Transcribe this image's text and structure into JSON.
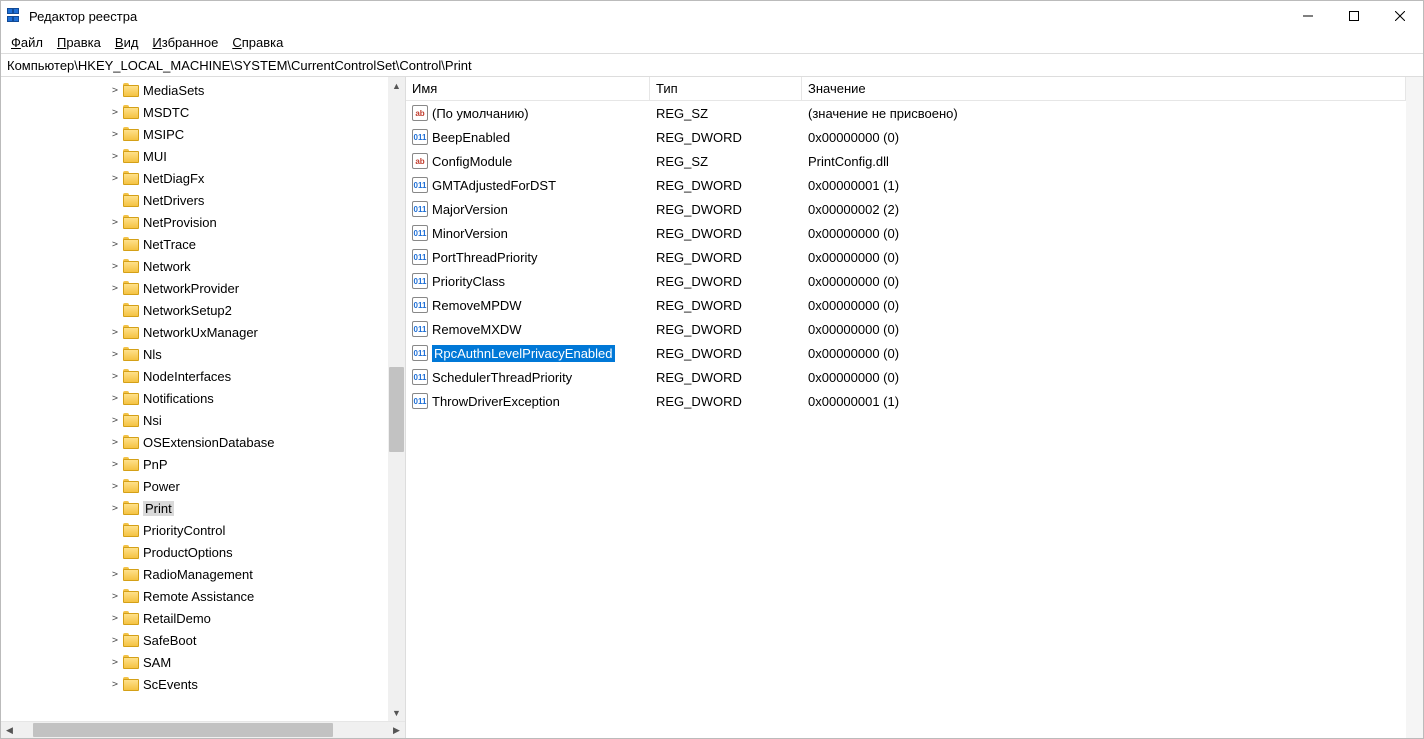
{
  "window": {
    "title": "Редактор реестра"
  },
  "menu": {
    "file": {
      "text": "Файл",
      "ul": "Ф",
      "rest": "айл"
    },
    "edit": {
      "text": "Правка",
      "ul": "П",
      "rest": "равка"
    },
    "view": {
      "text": "Вид",
      "ul": "В",
      "rest": "ид"
    },
    "fav": {
      "text": "Избранное",
      "ul": "И",
      "rest": "збранное"
    },
    "help": {
      "text": "Справка",
      "ul": "С",
      "rest": "правка"
    }
  },
  "address": "Компьютер\\HKEY_LOCAL_MACHINE\\SYSTEM\\CurrentControlSet\\Control\\Print",
  "tree": [
    {
      "indent": 128,
      "expand": ">",
      "label": "MediaSets"
    },
    {
      "indent": 128,
      "expand": ">",
      "label": "MSDTC"
    },
    {
      "indent": 128,
      "expand": ">",
      "label": "MSIPC"
    },
    {
      "indent": 128,
      "expand": ">",
      "label": "MUI"
    },
    {
      "indent": 128,
      "expand": ">",
      "label": "NetDiagFx"
    },
    {
      "indent": 128,
      "expand": "",
      "label": "NetDrivers"
    },
    {
      "indent": 128,
      "expand": ">",
      "label": "NetProvision"
    },
    {
      "indent": 128,
      "expand": ">",
      "label": "NetTrace"
    },
    {
      "indent": 128,
      "expand": ">",
      "label": "Network"
    },
    {
      "indent": 128,
      "expand": ">",
      "label": "NetworkProvider"
    },
    {
      "indent": 128,
      "expand": "",
      "label": "NetworkSetup2"
    },
    {
      "indent": 128,
      "expand": ">",
      "label": "NetworkUxManager"
    },
    {
      "indent": 128,
      "expand": ">",
      "label": "Nls"
    },
    {
      "indent": 128,
      "expand": ">",
      "label": "NodeInterfaces"
    },
    {
      "indent": 128,
      "expand": ">",
      "label": "Notifications"
    },
    {
      "indent": 128,
      "expand": ">",
      "label": "Nsi"
    },
    {
      "indent": 128,
      "expand": ">",
      "label": "OSExtensionDatabase"
    },
    {
      "indent": 128,
      "expand": ">",
      "label": "PnP"
    },
    {
      "indent": 128,
      "expand": ">",
      "label": "Power"
    },
    {
      "indent": 128,
      "expand": ">",
      "label": "Print",
      "selected": true
    },
    {
      "indent": 128,
      "expand": "",
      "label": "PriorityControl"
    },
    {
      "indent": 128,
      "expand": "",
      "label": "ProductOptions"
    },
    {
      "indent": 128,
      "expand": ">",
      "label": "RadioManagement"
    },
    {
      "indent": 128,
      "expand": ">",
      "label": "Remote Assistance"
    },
    {
      "indent": 128,
      "expand": ">",
      "label": "RetailDemo"
    },
    {
      "indent": 128,
      "expand": ">",
      "label": "SafeBoot"
    },
    {
      "indent": 128,
      "expand": ">",
      "label": "SAM"
    },
    {
      "indent": 128,
      "expand": ">",
      "label": "ScEvents"
    }
  ],
  "list": {
    "headers": {
      "name": "Имя",
      "type": "Тип",
      "value": "Значение"
    },
    "rows": [
      {
        "icon": "sz",
        "name": "(По умолчанию)",
        "type": "REG_SZ",
        "value": "(значение не присвоено)"
      },
      {
        "icon": "dw",
        "name": "BeepEnabled",
        "type": "REG_DWORD",
        "value": "0x00000000 (0)"
      },
      {
        "icon": "sz",
        "name": "ConfigModule",
        "type": "REG_SZ",
        "value": "PrintConfig.dll"
      },
      {
        "icon": "dw",
        "name": "GMTAdjustedForDST",
        "type": "REG_DWORD",
        "value": "0x00000001 (1)"
      },
      {
        "icon": "dw",
        "name": "MajorVersion",
        "type": "REG_DWORD",
        "value": "0x00000002 (2)"
      },
      {
        "icon": "dw",
        "name": "MinorVersion",
        "type": "REG_DWORD",
        "value": "0x00000000 (0)"
      },
      {
        "icon": "dw",
        "name": "PortThreadPriority",
        "type": "REG_DWORD",
        "value": "0x00000000 (0)"
      },
      {
        "icon": "dw",
        "name": "PriorityClass",
        "type": "REG_DWORD",
        "value": "0x00000000 (0)"
      },
      {
        "icon": "dw",
        "name": "RemoveMPDW",
        "type": "REG_DWORD",
        "value": "0x00000000 (0)"
      },
      {
        "icon": "dw",
        "name": "RemoveMXDW",
        "type": "REG_DWORD",
        "value": "0x00000000 (0)"
      },
      {
        "icon": "dw",
        "name": "RpcAuthnLevelPrivacyEnabled",
        "type": "REG_DWORD",
        "value": "0x00000000 (0)",
        "selected": true
      },
      {
        "icon": "dw",
        "name": "SchedulerThreadPriority",
        "type": "REG_DWORD",
        "value": "0x00000000 (0)"
      },
      {
        "icon": "dw",
        "name": "ThrowDriverException",
        "type": "REG_DWORD",
        "value": "0x00000001 (1)"
      }
    ]
  }
}
